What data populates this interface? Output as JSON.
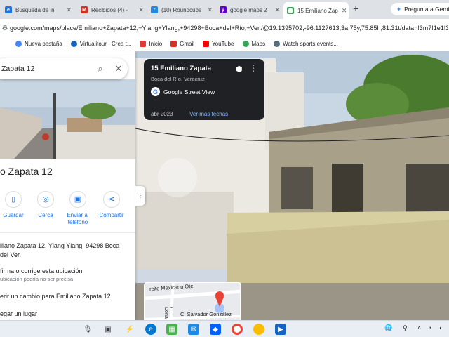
{
  "browser": {
    "tabs": [
      {
        "title": "Búsqueda de in",
        "icon": "ie-icon",
        "color": "#1a73e8"
      },
      {
        "title": "Recibidos (4) -",
        "icon": "gmail-icon",
        "color": "#d93025"
      },
      {
        "title": "(10) Roundcube",
        "icon": "roundcube-icon",
        "color": "#1e88e5"
      },
      {
        "title": "google maps 2",
        "icon": "yahoo-icon",
        "color": "#6001d2"
      },
      {
        "title": "15 Emiliano Zap",
        "icon": "maps-pin-icon",
        "color": "#34a853"
      }
    ],
    "new_tab": "+",
    "gemini": "Pregunta a Gemini",
    "url": "google.com/maps/place/Emiliano+Zapata+12,+Ylang+Ylang,+94298+Boca+del+Río,+Ver./@19.1395702,-96.1127613,3a,75y,75.85h,81.31t/data=!3m7!1e1!3m5",
    "bookmarks": [
      "Nueva pestaña",
      "Virtualitour - Crea t...",
      "Inicio",
      "Gmail",
      "YouTube",
      "Maps",
      "Watch sports events..."
    ]
  },
  "maps": {
    "search_query": "Zapata 12",
    "place_title": "o Zapata 12",
    "actions": [
      "Guardar",
      "Cerca",
      "Enviar al teléfono",
      "Compartir"
    ],
    "address": "iliano Zapata 12, Ylang Ylang, 94298 Boca del Ver.",
    "confirm": "firma o corrige esta ubicación",
    "confirm_sub": "ubicación podría no ser precisa",
    "suggest": "erir un cambio para Emiliano Zapata 12",
    "add_place": "egar un lugar",
    "collapse": "‹"
  },
  "streetview": {
    "title": "15 Emiliano Zapata",
    "subtitle": "Boca del Río, Veracruz",
    "brand": "Google Street View",
    "date": "abr 2023",
    "more_dates": "Ver más fechas",
    "minimap_street1": "rcito Mexicano Ote",
    "minimap_street2": "C. Salvador González",
    "minimap_street3": "C. Dona"
  },
  "taskbar": {
    "icons": [
      "mic-icon",
      "task-view-icon",
      "copilot-icon",
      "edge-icon",
      "store-icon",
      "mail-icon",
      "dropbox-icon",
      "chrome-icon",
      "chrome-beta-icon",
      "app-icon"
    ]
  }
}
